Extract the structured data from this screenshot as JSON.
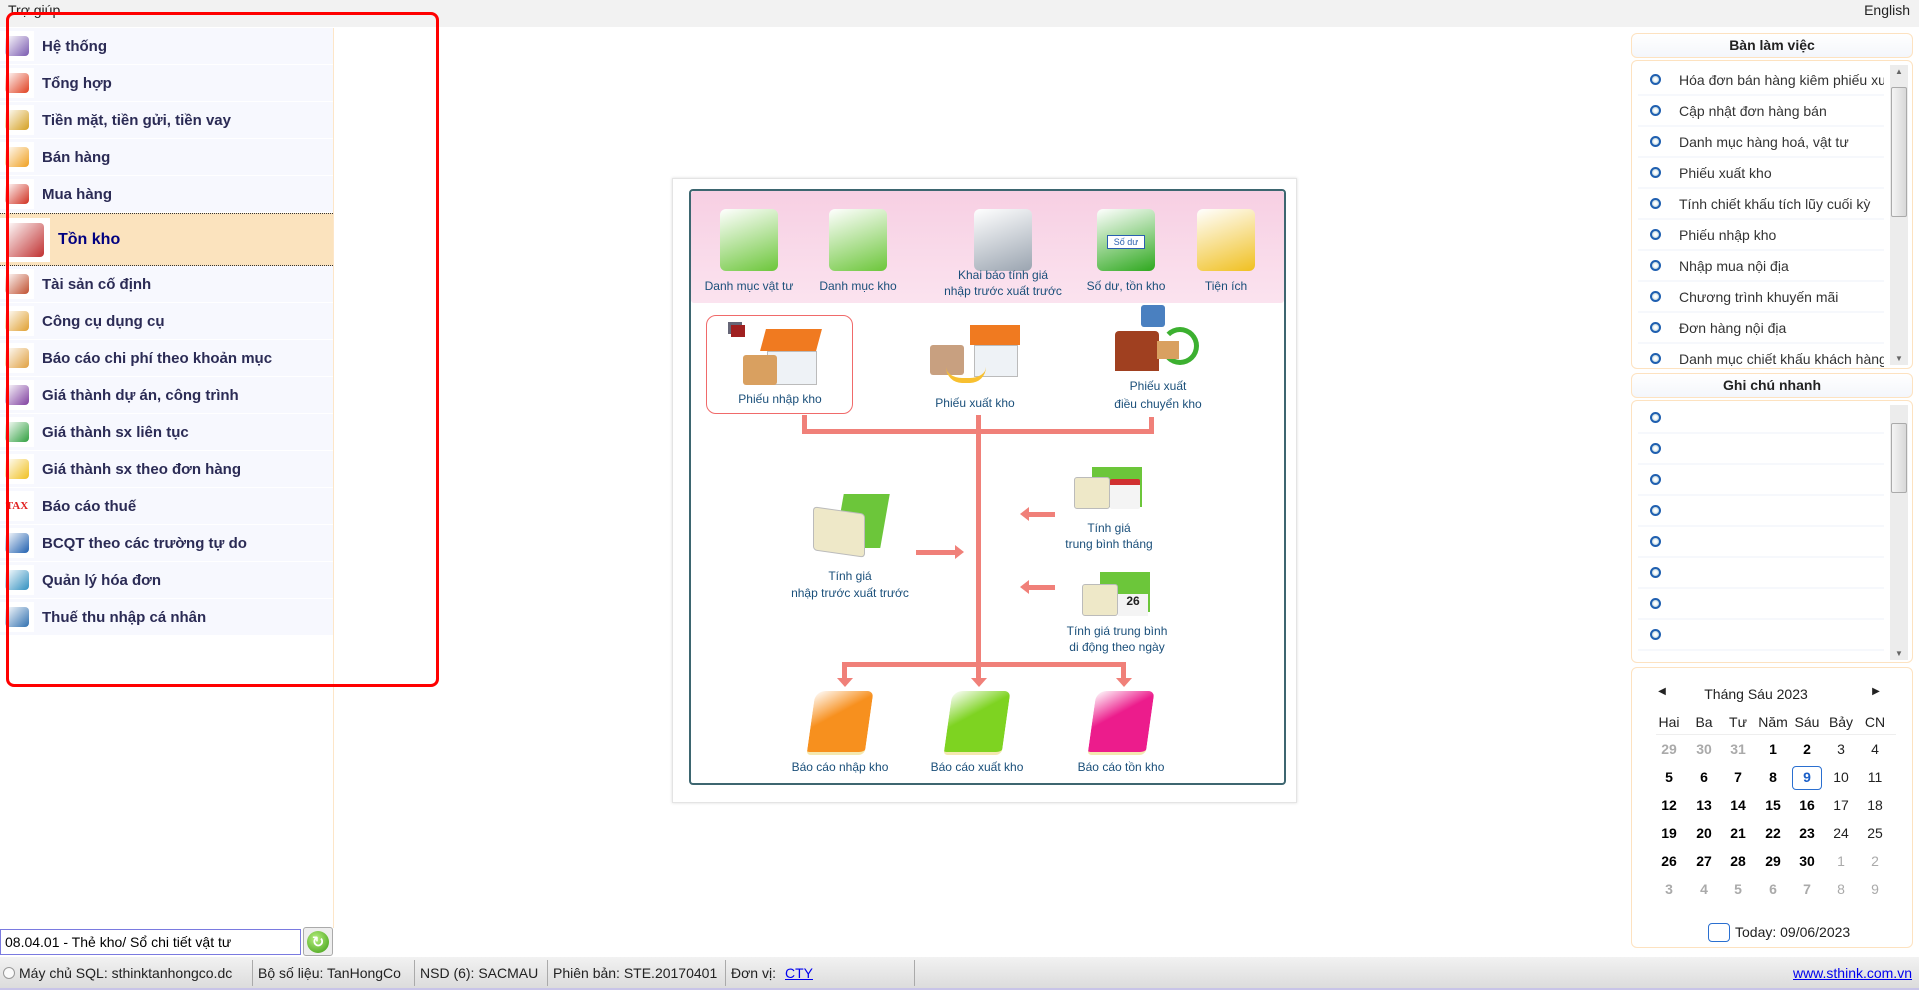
{
  "topbar": {
    "help": "Trợ giúp",
    "language": "English"
  },
  "sidebar": {
    "items": [
      {
        "label": "Hệ thống",
        "icon": "system-icon",
        "color": "#7a5ab0"
      },
      {
        "label": "Tổng hợp",
        "icon": "puzzle-globe-icon",
        "color": "#e04020"
      },
      {
        "label": "Tiền mặt, tiền gửi, tiền vay",
        "icon": "scale-icon",
        "color": "#d4a020"
      },
      {
        "label": "Bán hàng",
        "icon": "delivery-icon",
        "color": "#f0a020"
      },
      {
        "label": "Mua hàng",
        "icon": "cart-icon",
        "color": "#d03020"
      },
      {
        "label": "Tồn kho",
        "icon": "warehouse-icon",
        "color": "#c03030",
        "selected": true
      },
      {
        "label": "Tài sản cố định",
        "icon": "asset-icon",
        "color": "#c05030"
      },
      {
        "label": "Công cụ dụng cụ",
        "icon": "tools-icon",
        "color": "#e0a030"
      },
      {
        "label": "Báo cáo chi phí theo khoản mục",
        "icon": "report-folder-icon",
        "color": "#e0a040"
      },
      {
        "label": "Giá thành dự án, công trình",
        "icon": "bar-chart-icon",
        "color": "#8040a0"
      },
      {
        "label": "Giá thành sx liên tục",
        "icon": "gears-icon",
        "color": "#30a040"
      },
      {
        "label": "Giá thành sx theo đơn hàng",
        "icon": "folder-icon",
        "color": "#f0c020"
      },
      {
        "label": "Báo cáo thuế",
        "icon": "tax-icon",
        "color": "#e02020"
      },
      {
        "label": "BCQT theo các trường tự do",
        "icon": "binder-icon",
        "color": "#2060b0"
      },
      {
        "label": "Quản lý hóa đơn",
        "icon": "invoice-icon",
        "color": "#3090c0"
      },
      {
        "label": "Thuế thu nhập cá nhân",
        "icon": "person-folder-icon",
        "color": "#3070b0"
      }
    ]
  },
  "command": {
    "value": "08.04.01 - Thẻ kho/ Sổ chi tiết vật tư",
    "button_icon": "refresh-icon"
  },
  "status": {
    "server": "Máy chủ SQL: sthinktanhongco.dc",
    "dataset": "Bộ số liệu: TanHongCo",
    "user": "NSD (6): SACMAU",
    "version": "Phiên bản: STE.20170401",
    "unit_label": "Đơn vị:",
    "unit_link": "CTY",
    "website": "www.sthink.com.vn"
  },
  "diagram": {
    "top": [
      {
        "label": "Danh mục vật tư",
        "icon": "material-list-icon",
        "color": "#6cc63a"
      },
      {
        "label": "Danh mục kho",
        "icon": "warehouse-green-icon",
        "color": "#6cc63a"
      },
      {
        "label1": "Khai báo tính giá",
        "label2": "nhập trước xuất trước",
        "icon": "pen-document-icon",
        "color": "#9aa4b0"
      },
      {
        "label": "Số dư, tồn kho",
        "icon": "balance-folder-icon",
        "color": "#2ea81e",
        "badge": "Số dư"
      },
      {
        "label": "Tiện ích",
        "icon": "utility-tools-icon",
        "color": "#f0c020"
      }
    ],
    "receipt": "Phiếu nhập kho",
    "issue": "Phiếu xuất kho",
    "transfer1": "Phiếu xuất",
    "transfer2": "điều chuyển  kho",
    "fifo1": "Tính giá",
    "fifo2": "nhập trước xuất trước",
    "monthly1": "Tính giá",
    "monthly2": "trung bình tháng",
    "moving1": "Tính giá trung bình",
    "moving2": "di động theo ngày",
    "calendar_day": "26",
    "reports": [
      {
        "label": "Báo cáo nhập kho",
        "color": "#f7901e"
      },
      {
        "label": "Báo cáo xuất kho",
        "color": "#7ed321"
      },
      {
        "label": "Báo cáo tồn kho",
        "color": "#ec1c8c"
      }
    ],
    "line_color": "#f08079"
  },
  "workspace": {
    "title": "Bàn làm việc",
    "items": [
      "Hóa đơn bán hàng kiêm phiếu xuất",
      "Cập nhật đơn hàng bán",
      "Danh mục hàng hoá, vật tư",
      "Phiếu xuất kho",
      "Tính chiết khấu tích lũy cuối kỳ",
      "Phiếu nhập kho",
      "Nhập mua nội địa",
      "Chương trình khuyến mãi",
      "Đơn hàng nội địa",
      "Danh mục chiết khấu khách hàng"
    ]
  },
  "notes": {
    "title": "Ghi chú nhanh",
    "count": 8
  },
  "calendar": {
    "month": "Tháng Sáu 2023",
    "weekdays": [
      "Hai",
      "Ba",
      "Tư",
      "Năm",
      "Sáu",
      "Bảy",
      "CN"
    ],
    "weeks": [
      [
        "29",
        "30",
        "31",
        "1",
        "2",
        "3",
        "4"
      ],
      [
        "5",
        "6",
        "7",
        "8",
        "9",
        "10",
        "11"
      ],
      [
        "12",
        "13",
        "14",
        "15",
        "16",
        "17",
        "18"
      ],
      [
        "19",
        "20",
        "21",
        "22",
        "23",
        "24",
        "25"
      ],
      [
        "26",
        "27",
        "28",
        "29",
        "30",
        "1",
        "2"
      ],
      [
        "3",
        "4",
        "5",
        "6",
        "7",
        "8",
        "9"
      ]
    ],
    "selected": "9",
    "today": "Today: 09/06/2023"
  }
}
